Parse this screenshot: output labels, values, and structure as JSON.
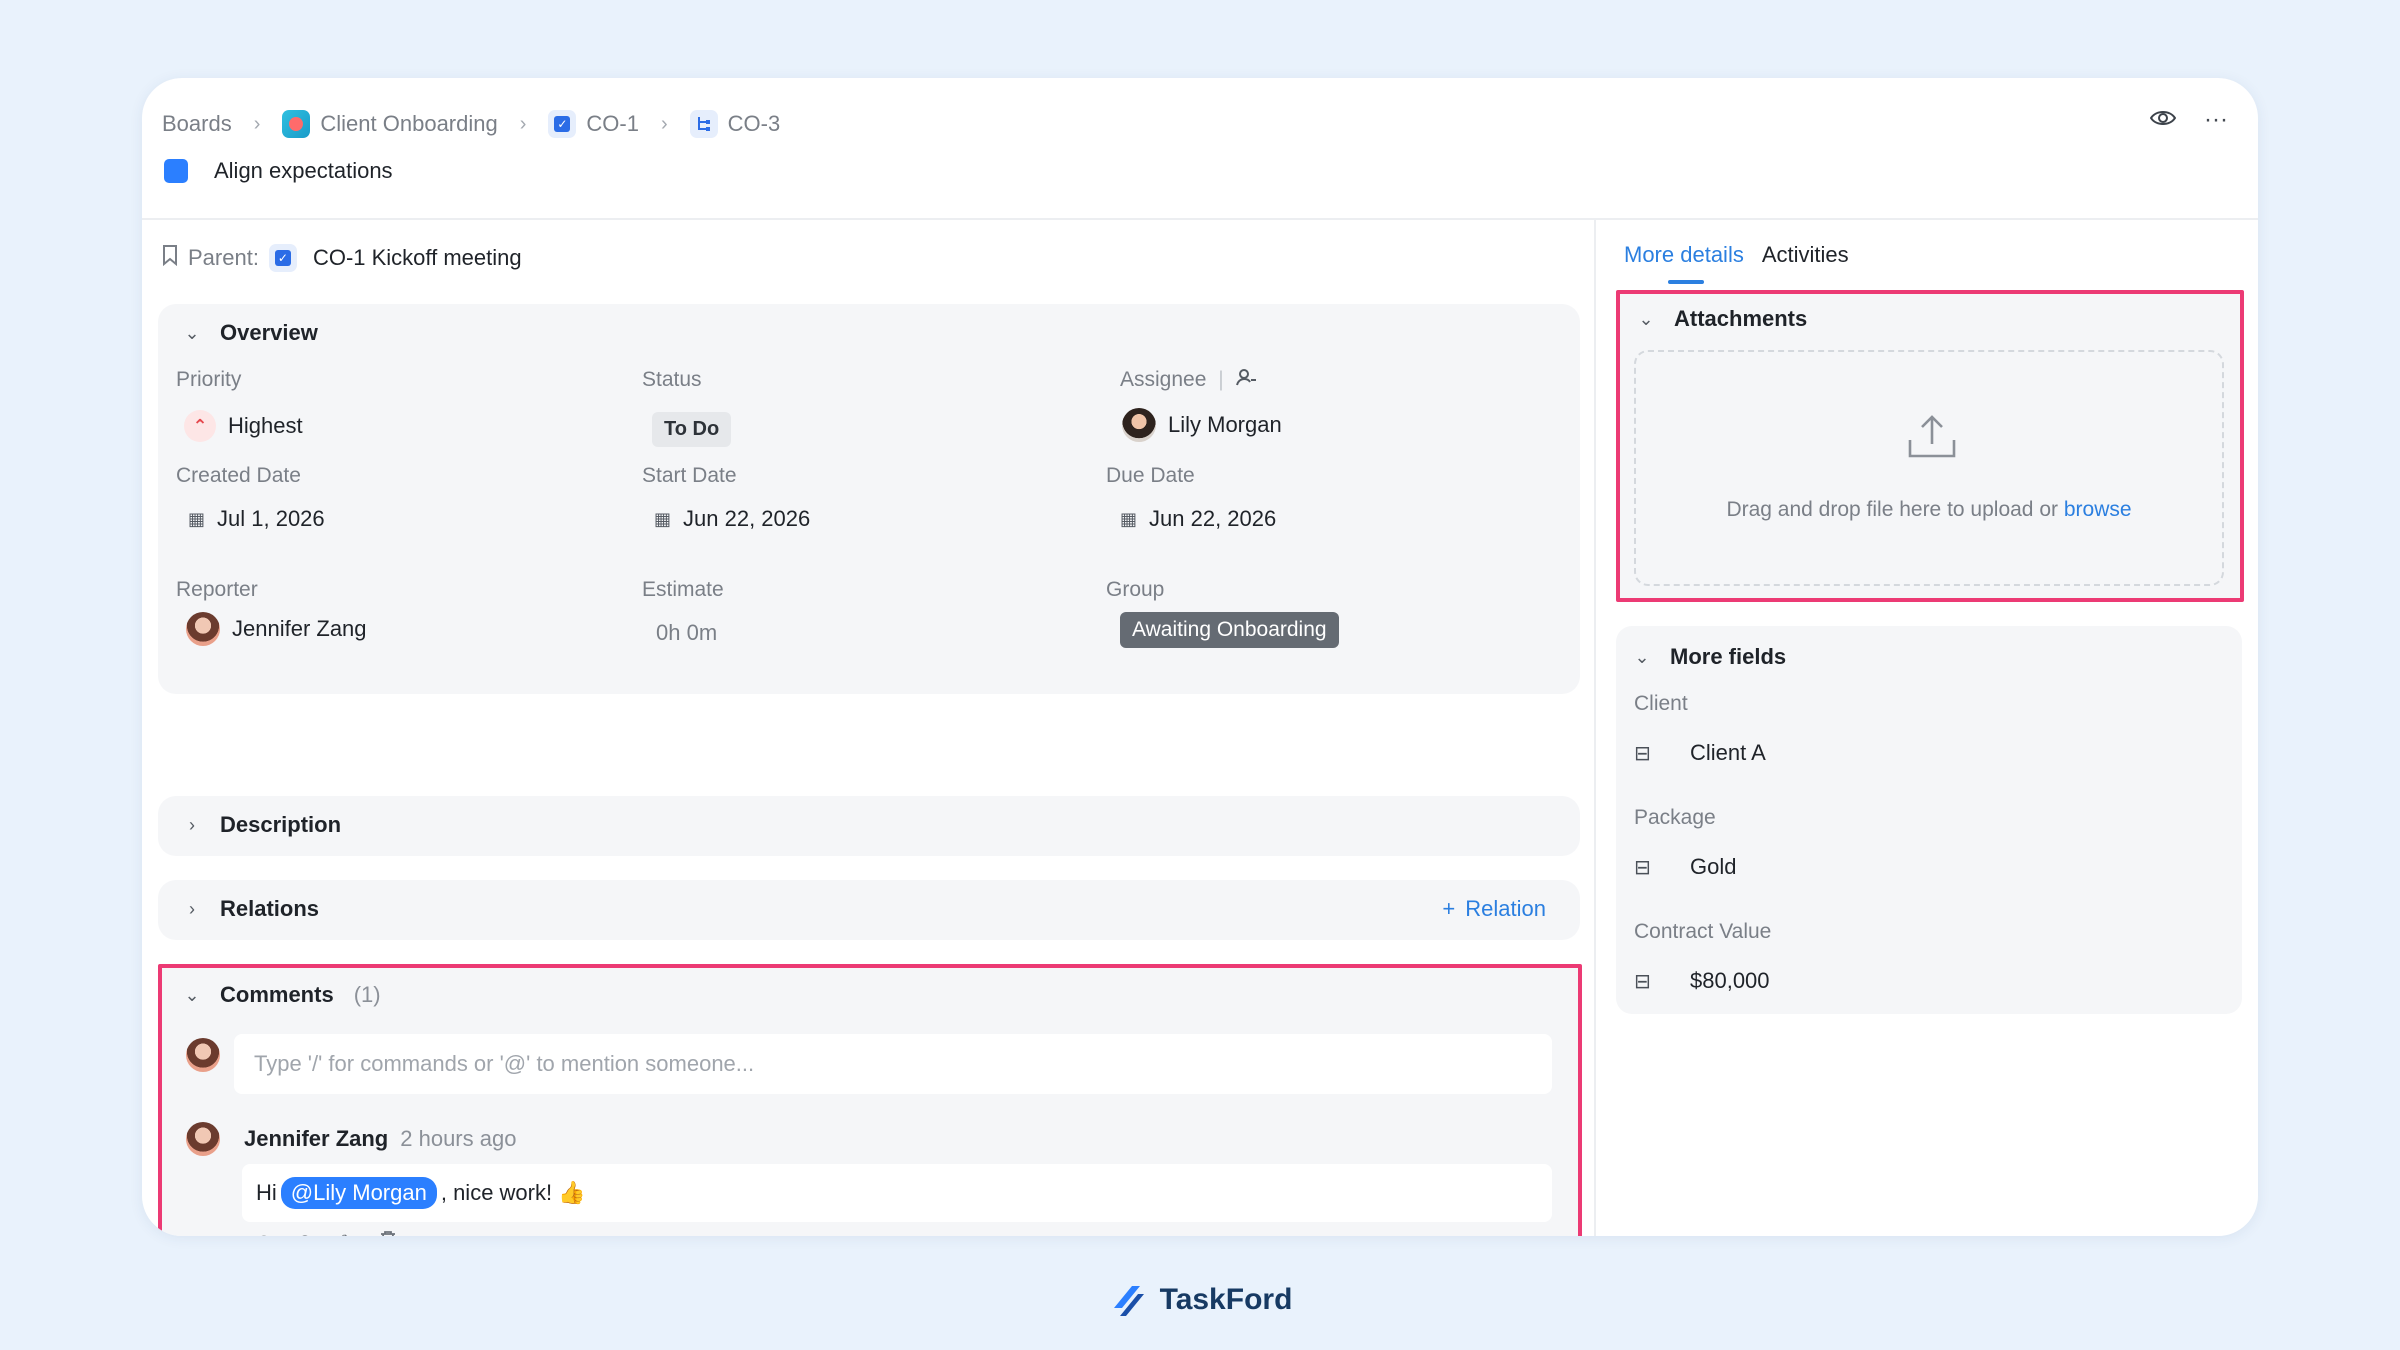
{
  "breadcrumb": {
    "boards": "Boards",
    "project": "Client Onboarding",
    "parent_key": "CO-1",
    "task_key": "CO-3"
  },
  "task": {
    "title": "Align expectations"
  },
  "parent": {
    "label": "Parent:",
    "value": "CO-1 Kickoff meeting"
  },
  "overview": {
    "heading": "Overview",
    "priority_label": "Priority",
    "priority": "Highest",
    "status_label": "Status",
    "status": "To Do",
    "assignee_label": "Assignee",
    "assignee": "Lily Morgan",
    "created_label": "Created Date",
    "created": "Jul 1, 2026",
    "start_label": "Start Date",
    "start": "Jun 22, 2026",
    "due_label": "Due Date",
    "due": "Jun 22, 2026",
    "reporter_label": "Reporter",
    "reporter": "Jennifer Zang",
    "estimate_label": "Estimate",
    "estimate": "0h 0m",
    "group_label": "Group",
    "group": "Awaiting Onboarding"
  },
  "description": {
    "heading": "Description"
  },
  "relations": {
    "heading": "Relations",
    "add_label": "Relation"
  },
  "comments": {
    "heading": "Comments",
    "count": "(1)",
    "placeholder": "Type '/' for commands or '@' to mention someone...",
    "items": [
      {
        "author": "Jennifer Zang",
        "time": "2 hours ago",
        "prefix": "Hi",
        "mention": "@Lily Morgan",
        "suffix": ", nice work! 👍"
      }
    ]
  },
  "right_tabs": {
    "active": "More details",
    "other": "Activities"
  },
  "attachments": {
    "heading": "Attachments",
    "drop_text": "Drag and drop file here to upload or",
    "browse": "browse"
  },
  "more_fields": {
    "heading": "More fields",
    "fields": [
      {
        "label": "Client",
        "value": "Client A"
      },
      {
        "label": "Package",
        "value": "Gold"
      },
      {
        "label": "Contract Value",
        "value": "$80,000"
      }
    ]
  },
  "brand": {
    "name": "TaskFord"
  },
  "colors": {
    "accent": "#2b7fe0",
    "highlight": "#ec3a74",
    "priority": "#e5484d"
  }
}
